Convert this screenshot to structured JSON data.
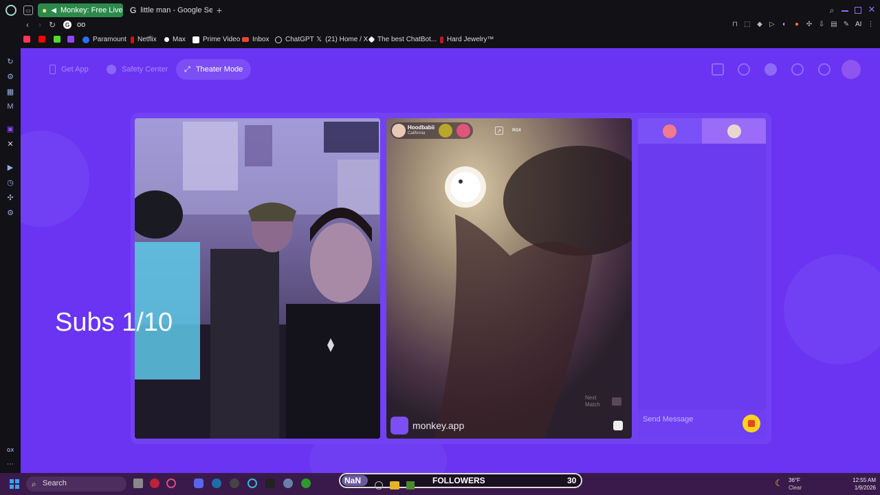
{
  "browser": {
    "tabs": [
      {
        "label": "Monkey: Free Live Vid",
        "active": true
      },
      {
        "label": "little man - Google Search",
        "active": false
      }
    ],
    "address": "oo",
    "bookmarks": [
      {
        "label": "Paramount"
      },
      {
        "label": "Netflix"
      },
      {
        "label": "Max"
      },
      {
        "label": "Prime Video"
      },
      {
        "label": "Inbox"
      },
      {
        "label": "ChatGPT"
      },
      {
        "label": "(21) Home / X"
      },
      {
        "label": "The best ChatBot..."
      },
      {
        "label": "Hard Jewelry™"
      }
    ],
    "ai_label": "AI",
    "gx_label": "GX"
  },
  "app": {
    "nav": {
      "get_app": "Get App",
      "safety_center": "Safety Center",
      "theater_mode": "Theater Mode"
    },
    "overlay_text": "Subs 1/10",
    "remote": {
      "username": "Hoodbabii",
      "location": "California",
      "region_badge": "RGX",
      "watermark": "monkey.app",
      "next_match": "Next\nMatch"
    },
    "chat": {
      "placeholder": "Send Message"
    },
    "colors": {
      "brand": "#6a34f2",
      "accent": "#ffd21f"
    }
  },
  "taskbar": {
    "search": "Search",
    "stream_overlay": {
      "left": "NaN",
      "label": "FOLLOWERS",
      "count": "30"
    },
    "weather": {
      "temp": "36°F",
      "cond": "Clear"
    },
    "clock": {
      "time": "12:55 AM",
      "date": "1/9/2026"
    }
  }
}
